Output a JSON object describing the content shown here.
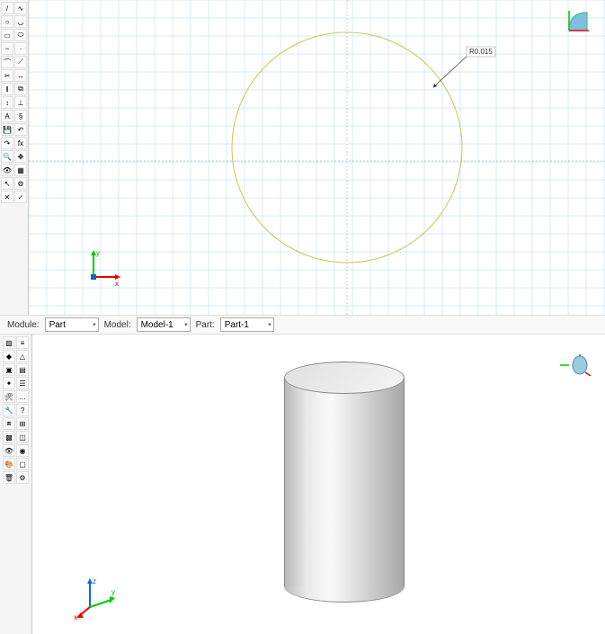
{
  "sketch": {
    "dimension_label": "R0.015",
    "tools": [
      [
        "line",
        "polyline"
      ],
      [
        "circle",
        "arc"
      ],
      [
        "rectangle",
        "ellipse"
      ],
      [
        "spline",
        "point"
      ],
      [
        "fillet",
        "chamfer"
      ],
      [
        "trim",
        "extend"
      ],
      [
        "offset",
        "mirror"
      ],
      [
        "dimension",
        "constraint"
      ],
      [
        "text",
        "symbol"
      ],
      [
        "save",
        "undo"
      ],
      [
        "redo",
        "fx"
      ],
      [
        "zoom",
        "pan"
      ],
      [
        "view",
        "grid"
      ],
      [
        "select",
        "options"
      ],
      [
        "exit",
        "done"
      ]
    ],
    "triad": {
      "y": "y",
      "x": "x"
    }
  },
  "contextbar": {
    "module_label": "Module:",
    "module_value": "Part",
    "model_label": "Model:",
    "model_value": "Model-1",
    "part_label": "Part:",
    "part_value": "Part-1"
  },
  "part": {
    "tools": [
      [
        "create-part",
        "part-manager"
      ],
      [
        "shape",
        "geometry"
      ],
      [
        "feature",
        "partition"
      ],
      [
        "datum",
        "sets"
      ],
      [
        "tools",
        "misc"
      ],
      [
        "repair",
        "query"
      ],
      [
        "assembly",
        "instance"
      ],
      [
        "mesh",
        "section"
      ],
      [
        "view",
        "render"
      ],
      [
        "color",
        "display"
      ],
      [
        "delete",
        "options"
      ]
    ],
    "triad": {
      "z": "z",
      "y": "y",
      "x": "x"
    }
  }
}
